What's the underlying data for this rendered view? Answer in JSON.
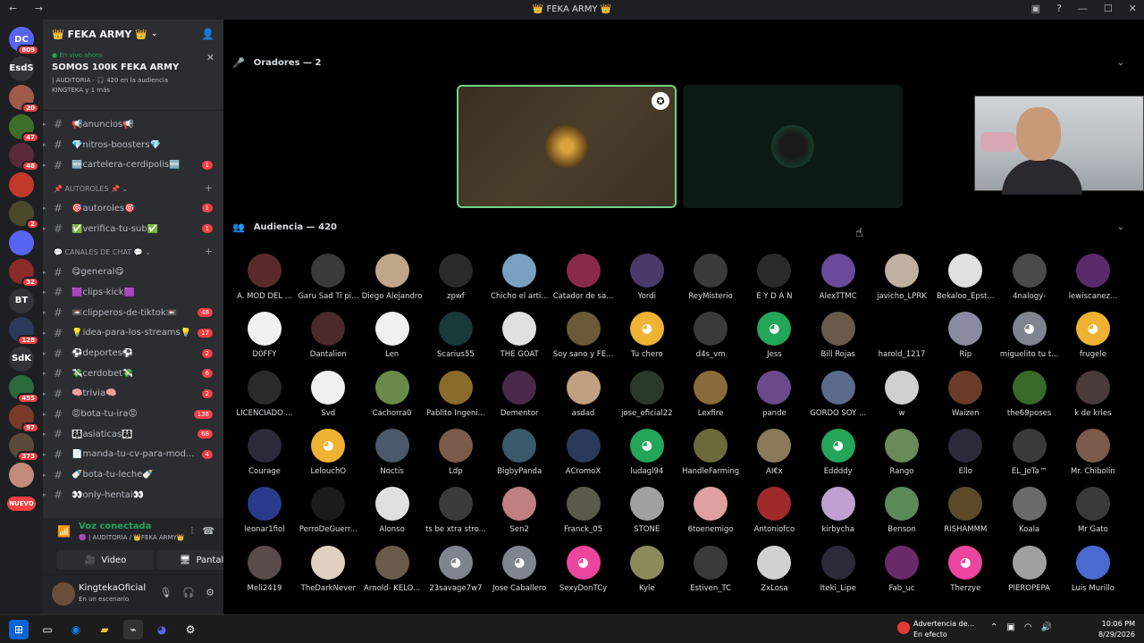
{
  "window": {
    "title": "👑 FEKA ARMY 👑",
    "nav": "← →",
    "controls": [
      "▣",
      "?",
      "—",
      "☐",
      "✕"
    ]
  },
  "servers": [
    {
      "label": "DC",
      "badge": "809",
      "color": "#5865f2"
    },
    {
      "label": "EsdS",
      "badge": "",
      "color": "#313338"
    },
    {
      "label": "",
      "badge": "20",
      "color": "#a05a4a"
    },
    {
      "label": "",
      "badge": "47",
      "color": "#3c6e2a"
    },
    {
      "label": "",
      "badge": "48",
      "color": "#5a2a3a"
    },
    {
      "label": "",
      "badge": "",
      "color": "#c0392b"
    },
    {
      "label": "",
      "badge": "2",
      "color": "#4a4a2a"
    },
    {
      "label": "",
      "badge": "",
      "color": "#5865f2"
    },
    {
      "label": "",
      "badge": "32",
      "color": "#8a2a2a"
    },
    {
      "label": "BT",
      "badge": "",
      "color": "#313338"
    },
    {
      "label": "",
      "badge": "128",
      "color": "#2a3a5a"
    },
    {
      "label": "SdK",
      "badge": "",
      "color": "#313338"
    },
    {
      "label": "",
      "badge": "455",
      "color": "#2a6a3a"
    },
    {
      "label": "",
      "badge": "97",
      "color": "#7a3a2a"
    },
    {
      "label": "",
      "badge": "373",
      "color": "#5a4a3a"
    },
    {
      "label": "",
      "badge": "",
      "color": "#c28a7a"
    },
    {
      "label": "NUEVO",
      "badge": "",
      "color": "#f23f43"
    }
  ],
  "guild": {
    "name": "👑 FEKA ARMY 👑",
    "live_now": "● En vivo ahora",
    "stage_title": "SOMOS 100K FEKA ARMY",
    "stage_meta": "| AUDITORIA · 🎧 420 en la audiencia",
    "stage_speakers": "KINGTEKA y 1 más"
  },
  "channels": [
    {
      "type": "chan",
      "name": "📢anuncios📢",
      "count": ""
    },
    {
      "type": "chan",
      "name": "💎nitros-boosters💎",
      "count": ""
    },
    {
      "type": "chan",
      "name": "🆕cartelera-cerdipolis🆕",
      "count": "1"
    },
    {
      "type": "cat",
      "name": "📌 AUTOROLES 📌 ⌄"
    },
    {
      "type": "chan",
      "name": "🎯autoroles🎯",
      "count": "1"
    },
    {
      "type": "chan",
      "name": "✅verifica-tu-sub✅",
      "count": "1"
    },
    {
      "type": "cat",
      "name": "💬 CANALES DE CHAT 💬 ⌄"
    },
    {
      "type": "chan",
      "name": "😋general😋",
      "count": ""
    },
    {
      "type": "chan",
      "name": "🟪clips-kick🟪",
      "count": ""
    },
    {
      "type": "chan",
      "name": "📼clipperos-de-tiktok📼",
      "count": "48"
    },
    {
      "type": "chan",
      "name": "💡idea-para-los-streams💡",
      "count": "17"
    },
    {
      "type": "chan",
      "name": "⚽deportes⚽",
      "count": "2"
    },
    {
      "type": "chan",
      "name": "💸cerdobet💸",
      "count": "6"
    },
    {
      "type": "chan",
      "name": "🧠trivia🧠",
      "count": "2"
    },
    {
      "type": "chan",
      "name": "😡bota-tu-ira😡",
      "count": "138"
    },
    {
      "type": "chan",
      "name": "👩‍👩‍👧asiaticas👩‍👩‍👧",
      "count": "68"
    },
    {
      "type": "chan",
      "name": "📄manda-tu-cv-para-mod...",
      "count": "4"
    },
    {
      "type": "chan",
      "name": "🍼bota-tu-leche🍼",
      "count": ""
    },
    {
      "type": "chan",
      "name": "👀only-hentai👀",
      "count": ""
    }
  ],
  "voice": {
    "status": "Voz conectada",
    "location": "🟣 | AUDITORIA / 👑FEKA ARMY👑",
    "video": "Video",
    "screen": "Pantalla"
  },
  "user": {
    "name": "KingtekaOficial",
    "status": "En un escenario"
  },
  "stage": {
    "speakers_header": "Oradores — 2",
    "audience_header": "Audiencia — 420"
  },
  "audience": [
    [
      "A. MOD DEL ...",
      "Garu Sad Ti pi...",
      "Diego Alejandro",
      "zpwf",
      "Chicho el arti...",
      "Catador de sa...",
      "Yordi",
      "ReyMisterio",
      "E Y D A N",
      "AlexTTMC",
      "javicho_LPRK",
      "Bekaloo_Epst...",
      "4nalogy-",
      "lewiscanez..."
    ],
    [
      "D0FFY",
      "Dantalion",
      "Len",
      "Scarius55",
      "THE GOAT",
      "Soy sano y FE...",
      "Tu chero",
      "d4s_vm",
      "Jess",
      "Bill Rojas",
      "harold_1217",
      "Rip",
      "miguelito tu t...",
      "frugele"
    ],
    [
      "LICENCIADO ...",
      "Svd",
      "Cachorra0",
      "Pablito Ingeni...",
      "Dementor",
      "asdad",
      "jose_oficial22",
      "Lexfire",
      "pande",
      "GORDO SOY ...",
      "w",
      "Waizen",
      "the69poses",
      "k de krles"
    ],
    [
      "Courage",
      "LelouchO",
      "Noctis",
      "Ldp",
      "BigbyPanda",
      "ACromoX",
      "ludagl94",
      "HandleFarming",
      "AI€x",
      "Eddddy",
      "Rango",
      "Ello",
      "EL_JoTa™",
      "Mr. Chibolin"
    ],
    [
      "leonar1fiol",
      "PerroDeGuerr...",
      "Alonso",
      "ts be xtra stro...",
      "Sen2",
      "Franck_05",
      "STONE",
      "6toenemigo",
      "Antoniofco",
      "kirbycha",
      "Benson",
      "RISHAMMM",
      "Koala",
      "Mr Gato"
    ],
    [
      "Meli2419",
      "TheDarkNever",
      "Arnold- KELO...",
      "23savage7w7",
      "Jose Caballero",
      "SexyDonTCy",
      "Kyle",
      "Estiven_TC",
      "ZxLosa",
      "Iteki_Lipe",
      "Fab_uc",
      "Therzye",
      "PIEROPEPA",
      "Luis Murillo"
    ]
  ],
  "audience_colors": [
    [
      "#5a2a2a",
      "#3a3a3a",
      "#bfa58a",
      "#2a2a2a",
      "#7aa0c0",
      "#8a2a4a",
      "#4a3a6a",
      "#3a3a3a",
      "#2a2a2a",
      "#6a4a9a",
      "#c0b0a0",
      "#e0e0e0",
      "#4a4a4a",
      "#5a2a6a"
    ],
    [
      "#f0f0f0",
      "#4a2a2a",
      "#f0f0f0",
      "#1a3a3a",
      "#e0e0e0",
      "#6a5a3a",
      "#f0b232",
      "#3a3a3a",
      "#23a55a",
      "#6a5a4a",
      "#000000",
      "#8a8aa0",
      "#80848e",
      "#f0b232"
    ],
    [
      "#2a2a2a",
      "#f0f0f0",
      "#6a8a4a",
      "#8a6a2a",
      "#4a2a4a",
      "#c0a080",
      "#2a3a2a",
      "#8a6a3a",
      "#6a4a8a",
      "#5a6a8a",
      "#d0d0d0",
      "#6a3a2a",
      "#3a6a2a",
      "#4a3a3a"
    ],
    [
      "#2a2a3a",
      "#f0b232",
      "#4a5a6a",
      "#7a5a4a",
      "#3a5a6a",
      "#2a3a5a",
      "#23a55a",
      "#6a6a3a",
      "#8a7a5a",
      "#23a55a",
      "#6a8a5a",
      "#2a2a3a",
      "#3a3a3a",
      "#7a5a4a"
    ],
    [
      "#2a3a8a",
      "#1a1a1a",
      "#e0e0e0",
      "#3a3a3a",
      "#c08080",
      "#5a5a4a",
      "#a0a0a0",
      "#e0a0a0",
      "#a02a2a",
      "#c0a0d0",
      "#5a8a5a",
      "#5a4a2a",
      "#6a6a6a",
      "#3a3a3a"
    ],
    [
      "#5a4a4a",
      "#e0d0c0",
      "#6a5a4a",
      "#80848e",
      "#80848e",
      "#eb459e",
      "#8a8a5a",
      "#3a3a3a",
      "#d0d0d0",
      "#2a2a3a",
      "#6a2a6a",
      "#eb459e",
      "#a0a0a0",
      "#4a6ad0"
    ]
  ],
  "taskbar": {
    "warning_title": "Advertencia de...",
    "warning_sub": "En efecto",
    "time": "10:06 PM",
    "date": "8/29/2026"
  }
}
